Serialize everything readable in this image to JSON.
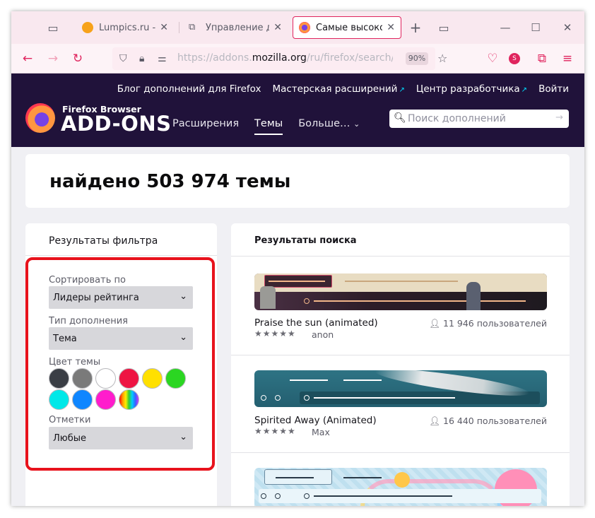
{
  "tabs": [
    {
      "title": "Lumpics.ru - поме",
      "active": false
    },
    {
      "title": "Управление допо",
      "active": false
    },
    {
      "title": "Самые высоко оц",
      "active": true
    }
  ],
  "url": {
    "prefix": "https://addons.",
    "domain": "mozilla.org",
    "suffix": "/ru/firefox/search/?sort=r",
    "zoom": "90%"
  },
  "profile_initial": "S",
  "amo": {
    "top_links": [
      "Блог дополнений для Firefox",
      "Мастерская расширений",
      "Центр разработчика",
      "Войти"
    ],
    "logo_small": "Firefox Browser",
    "logo_big": "ADD-ONS",
    "nav": [
      "Расширения",
      "Темы",
      "Больше…"
    ],
    "search_placeholder": "Поиск дополнений"
  },
  "heading": "найдено 503 974 темы",
  "filter": {
    "title": "Результаты фильтра",
    "sort_label": "Сортировать по",
    "sort_value": "Лидеры рейтинга",
    "type_label": "Тип дополнения",
    "type_value": "Тема",
    "color_label": "Цвет темы",
    "colors": [
      "#3a3e45",
      "#7a7a7a",
      "#ffffff",
      "#ee1443",
      "#ffe000",
      "#2bd622",
      "#00e8e8",
      "#0f86ff",
      "#ff1ccc",
      "rainbow"
    ],
    "tags_label": "Отметки",
    "tags_value": "Любые"
  },
  "results": {
    "title": "Результаты поиска",
    "items": [
      {
        "name": "Praise the sun (animated)",
        "users": "11 946 пользователей",
        "stars": "★★★★★",
        "author": "anon",
        "bg": "#3a2a38"
      },
      {
        "name": "Spirited Away (Animated)",
        "users": "16 440 пользователей",
        "stars": "★★★★★",
        "author": "Max",
        "bg": "#2b6a7a"
      },
      {
        "name": "",
        "users": "",
        "stars": "",
        "author": "",
        "bg": "#cde6f2"
      }
    ]
  }
}
